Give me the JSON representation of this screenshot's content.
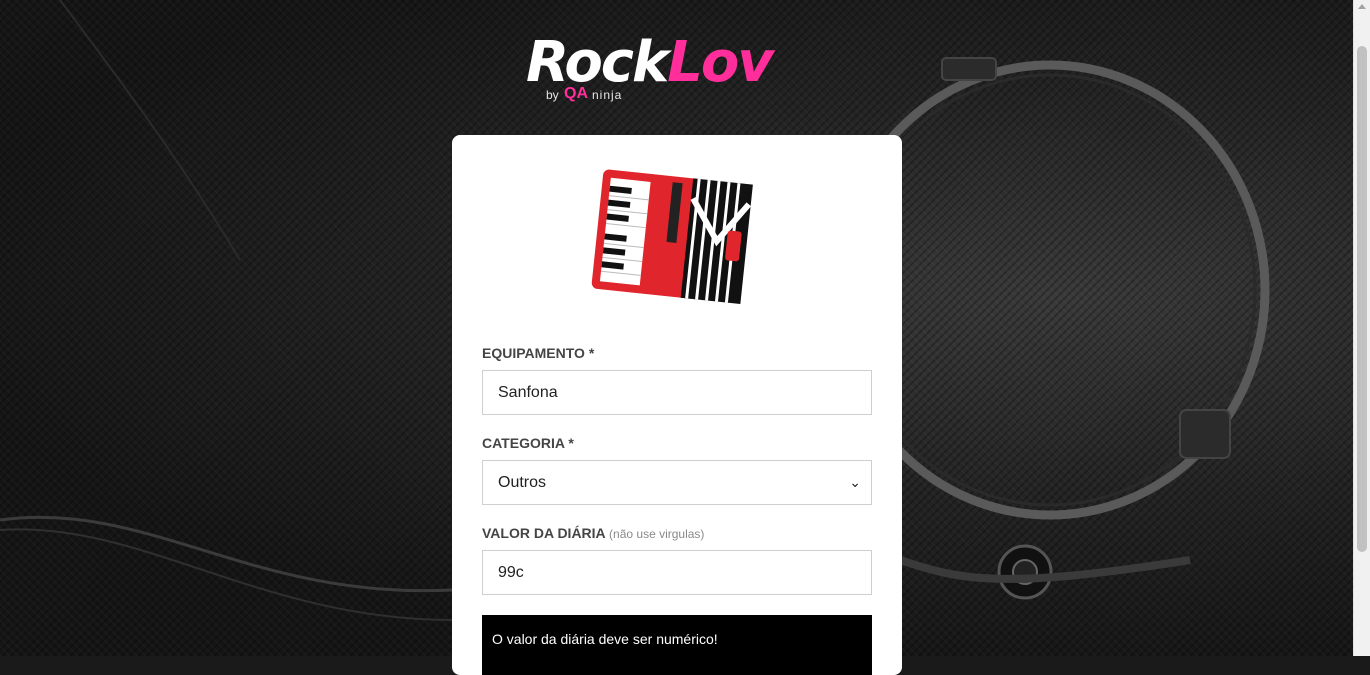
{
  "brand": {
    "rock": "Rock",
    "lov": "Lov",
    "by": "by",
    "qa": "QA",
    "ninja": "ninja"
  },
  "form": {
    "equipment_label": "EQUIPAMENTO *",
    "equipment_value": "Sanfona",
    "category_label": "CATEGORIA *",
    "category_value": "Outros",
    "price_label": "VALOR DA DIÁRIA",
    "price_hint": "(não use virgulas)",
    "price_value": "99c"
  },
  "alert": {
    "message": "O valor da diária deve ser numérico!"
  },
  "icons": {
    "select_arrow": "chevron-down-icon",
    "thumbnail": "accordion-image"
  },
  "colors": {
    "accent": "#ff2e9a",
    "alert_bg": "#000000",
    "card_bg": "#ffffff"
  }
}
